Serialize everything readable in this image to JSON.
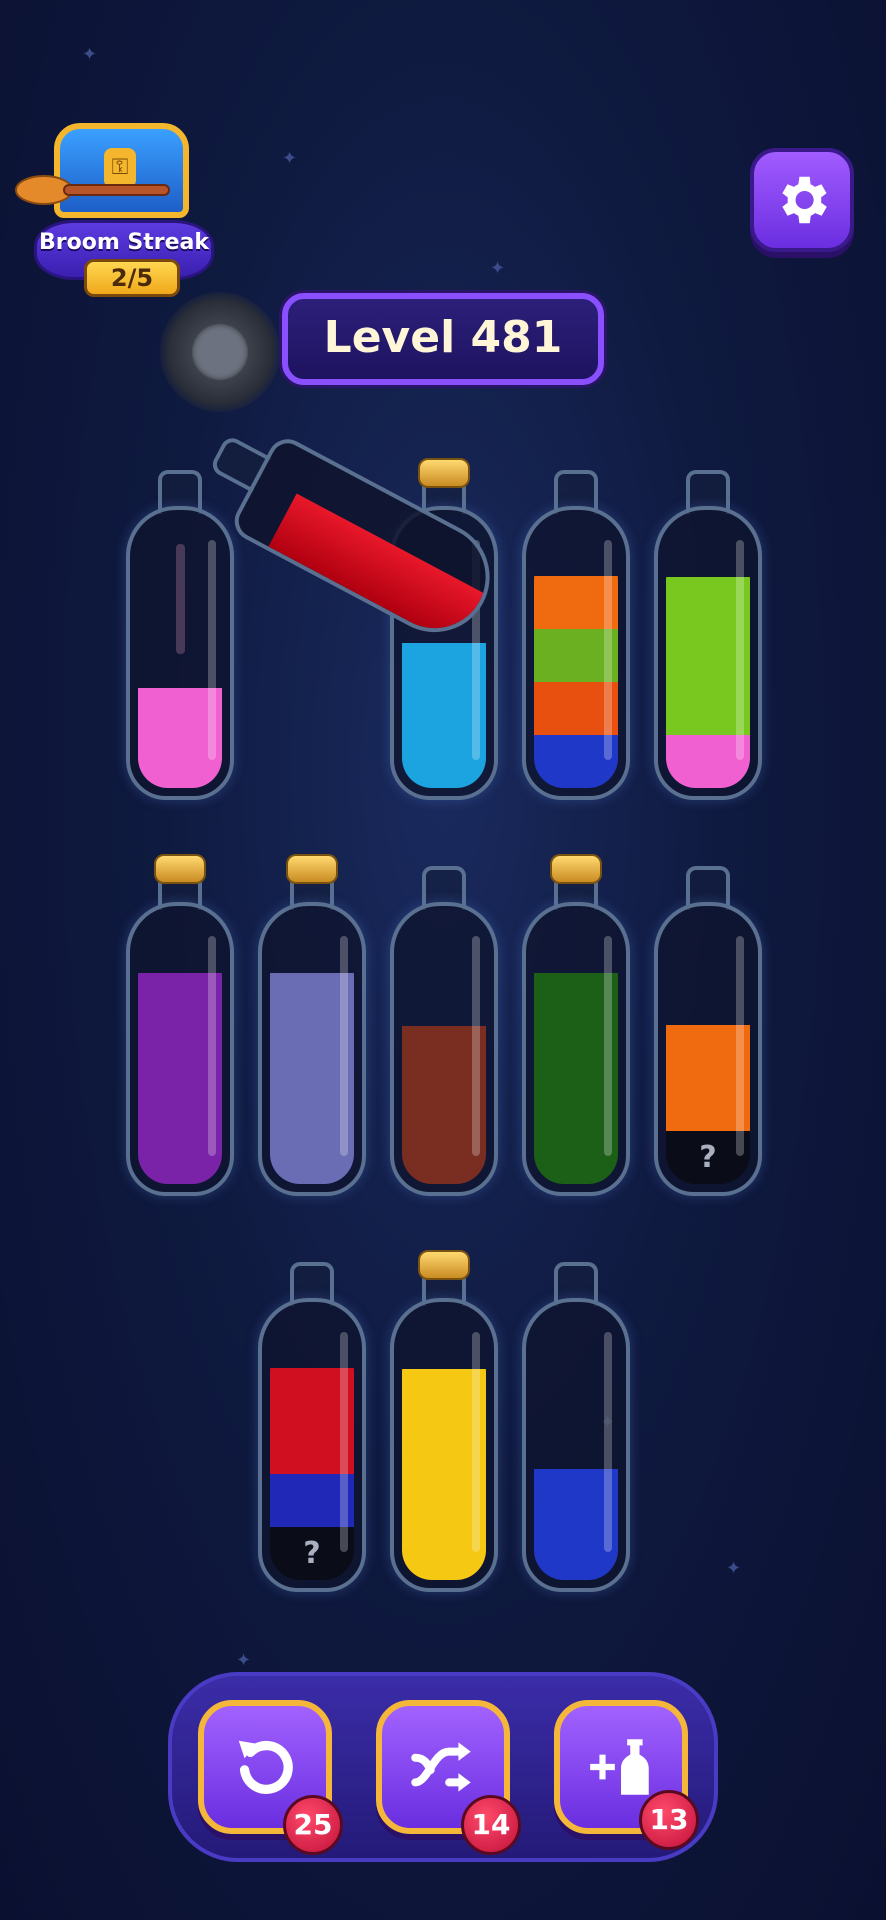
{
  "streak": {
    "title": "Broom Streak",
    "progress": "2/5"
  },
  "level": {
    "label": "Level 481"
  },
  "bottles": [
    {
      "id": "b1",
      "cap": false,
      "layers": [
        {
          "color": "#f060d0",
          "fill": 0.38
        }
      ]
    },
    {
      "id": "b2",
      "cap": true,
      "layers": [
        {
          "color": "#1ba4e0",
          "fill": 0.55
        }
      ]
    },
    {
      "id": "b3",
      "cap": false,
      "layers": [
        {
          "color": "#2038c8",
          "fill": 0.2
        },
        {
          "color": "#e85010",
          "fill": 0.2
        },
        {
          "color": "#6ab020",
          "fill": 0.2
        },
        {
          "color": "#f06a10",
          "fill": 0.2
        }
      ]
    },
    {
      "id": "b4",
      "cap": false,
      "layers": [
        {
          "color": "#f060d0",
          "fill": 0.2
        },
        {
          "color": "#78c820",
          "fill": 0.6
        }
      ]
    },
    {
      "id": "b5",
      "cap": true,
      "layers": [
        {
          "color": "#7a22a8",
          "fill": 0.8
        }
      ]
    },
    {
      "id": "b6",
      "cap": true,
      "layers": [
        {
          "color": "#6a6cb4",
          "fill": 0.8
        }
      ]
    },
    {
      "id": "b7",
      "cap": false,
      "layers": [
        {
          "color": "#7a2e22",
          "fill": 0.6
        }
      ]
    },
    {
      "id": "b8",
      "cap": true,
      "layers": [
        {
          "color": "#1c6018",
          "fill": 0.8
        }
      ]
    },
    {
      "id": "b9",
      "cap": false,
      "layers": [
        {
          "color": "#0a0d18",
          "fill": 0.2,
          "mystery": true
        },
        {
          "color": "#f06a10",
          "fill": 0.4
        }
      ]
    },
    {
      "id": "b10",
      "cap": false,
      "layers": [
        {
          "color": "#0a0d18",
          "fill": 0.2,
          "mystery": true
        },
        {
          "color": "#2028b8",
          "fill": 0.2
        },
        {
          "color": "#d01020",
          "fill": 0.4
        }
      ]
    },
    {
      "id": "b11",
      "cap": true,
      "layers": [
        {
          "color": "#f5c814",
          "fill": 0.8
        }
      ]
    },
    {
      "id": "b12",
      "cap": false,
      "layers": [
        {
          "color": "#2038c8",
          "fill": 0.42
        }
      ]
    }
  ],
  "mystery_glyph": "?",
  "tilted_bottle": {
    "color": "#d01020"
  },
  "tools": [
    {
      "name": "undo",
      "icon": "undo-icon",
      "count": "25"
    },
    {
      "name": "shuffle",
      "icon": "shuffle-icon",
      "count": "14"
    },
    {
      "name": "add-bottle",
      "icon": "add-bottle-icon",
      "count": "13"
    }
  ]
}
